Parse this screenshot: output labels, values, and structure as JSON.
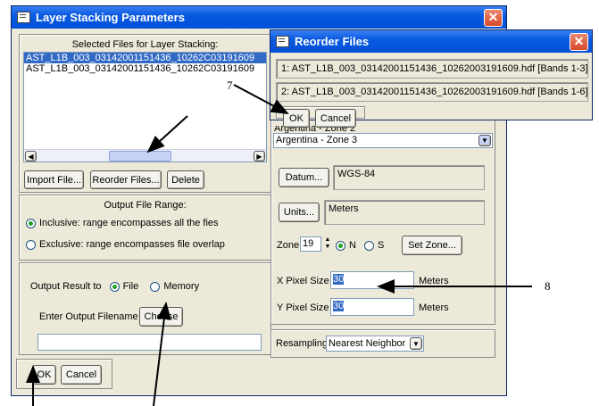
{
  "main_window": {
    "title": "Layer Stacking Parameters",
    "selected_files_header": "Selected Files for Layer Stacking:",
    "files": [
      "AST_L1B_003_03142001151436_10262C03191609",
      "AST_L1B_003_03142001151436_10262C03191609"
    ],
    "import_button": "Import File...",
    "reorder_button": "Reorder Files...",
    "delete_button": "Delete",
    "output_range_header": "Output File Range:",
    "inclusive_option": "Inclusive: range encompasses all the fies",
    "exclusive_option": "Exclusive: range encompasses file overlap",
    "output_result_label": "Output Result to",
    "file_option": "File",
    "memory_option": "Memory",
    "filename_label": "Enter Output Filename",
    "choose_button": "Choose",
    "filename_value": "",
    "ok_button": "OK",
    "cancel_button": "Cancel",
    "projection_partial": "Argentina - Zone 2",
    "projection_selected": "Argentina - Zone 3",
    "datum_button": "Datum...",
    "datum_value": "WGS-84",
    "units_button": "Units...",
    "units_value": "Meters",
    "zone_label": "Zone",
    "zone_value": "19",
    "n_option": "N",
    "s_option": "S",
    "set_zone_button": "Set Zone...",
    "x_pixel_label": "X Pixel Size",
    "x_pixel_value": "30",
    "x_pixel_units": "Meters",
    "y_pixel_label": "Y Pixel Size",
    "y_pixel_value": "30",
    "y_pixel_units": "Meters",
    "resampling_label": "Resampling",
    "resampling_value": "Nearest Neighbor"
  },
  "reorder_dialog": {
    "title": "Reorder Files",
    "items": [
      "1: AST_L1B_003_03142001151436_10262003191609.hdf [Bands 1-3]",
      "2: AST_L1B_003_03142001151436_10262003191609.hdf [Bands 1-6]"
    ],
    "ok_button": "OK",
    "cancel_button": "Cancel"
  },
  "annotations": {
    "label_7": "7",
    "label_8": "8"
  }
}
